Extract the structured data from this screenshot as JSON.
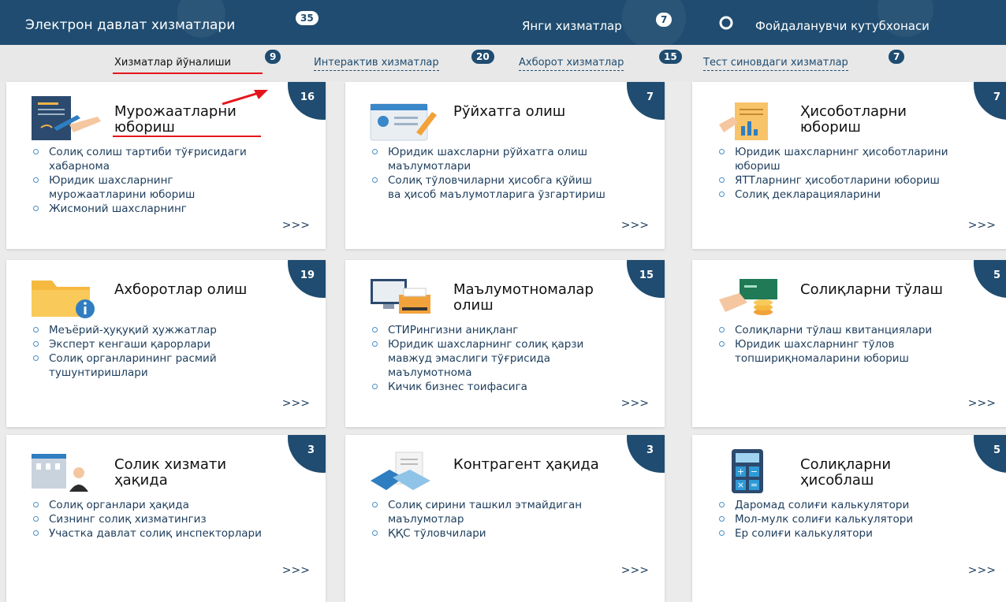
{
  "header": {
    "portal_title": "Электрон давлат хизматлари",
    "portal_count": "35",
    "new_services": "Янги хизматлар",
    "new_count": "7",
    "library": "Фойдаланувчи кутубхонаси"
  },
  "tabs": [
    {
      "label": "Хизматлар йўналиши",
      "count": "9"
    },
    {
      "label": "Интерактив хизматлар",
      "count": "20"
    },
    {
      "label": "Ахборот хизматлар",
      "count": "15"
    },
    {
      "label": "Тест синовдаги хизматлар",
      "count": "7"
    }
  ],
  "cards": [
    {
      "title": "Мурожаатларни юбориш",
      "count": "16",
      "icon": "document-pen-icon",
      "items": [
        "Солиқ солиш тартиби тўғрисидаги хабарнома",
        "Юридик шахсларнинг мурожаатларини юбориш",
        "Жисмоний шахсларнинг"
      ]
    },
    {
      "title": "Рўйхатга олиш",
      "count": "7",
      "icon": "id-card-icon",
      "items": [
        "Юридик шахсларни рўйхатга олиш маълумотлари",
        "Солиқ тўловчиларни ҳисобга қўйиш ва ҳисоб маълумотларига ўзгартириш"
      ]
    },
    {
      "title": "Ҳисоботларни юбориш",
      "count": "7",
      "icon": "report-chart-icon",
      "items": [
        "Юридик шахсларнинг ҳисоботларини юбориш",
        "ЯТТларнинг ҳисоботларини юбориш",
        "Солиқ декларацияларини"
      ]
    },
    {
      "title": "Ахборотлар олиш",
      "count": "19",
      "icon": "folder-info-icon",
      "items": [
        "Меъёрий-ҳуқуқий ҳужжатлар",
        "Эксперт кенгаши қарорлари",
        "Солиқ органларининг расмий тушунтиришлари"
      ]
    },
    {
      "title": "Маълумотномалар олиш",
      "count": "15",
      "icon": "computer-printer-icon",
      "items": [
        "СТИРингизни аниқланг",
        "Юридик шахсларнинг солиқ қарзи мавжуд эмаслиги тўғрисида маълумотнома",
        "Кичик бизнес тоифасига"
      ]
    },
    {
      "title": "Солиқларни тўлаш",
      "count": "5",
      "icon": "payment-card-icon",
      "items": [
        "Солиқларни тўлаш квитанциялари",
        "Юридик шахсларнинг тўлов топшириқномаларини юбориш"
      ]
    },
    {
      "title": "Солик хизмати ҳақида",
      "count": "3",
      "icon": "office-building-icon",
      "items": [
        "Солиқ органлари ҳақида",
        "Сизнинг солиқ хизматингиз",
        "Участка давлат солиқ инспекторлари"
      ]
    },
    {
      "title": "Контрагент ҳақида",
      "count": "3",
      "icon": "handshake-icon",
      "items": [
        "Солиқ сирини ташкил этмайдиган маълумотлар",
        "ҚҚС тўловчилари"
      ]
    },
    {
      "title": "Солиқларни ҳисоблаш",
      "count": "5",
      "icon": "calculator-icon",
      "items": [
        "Даромад солиғи калькулятори",
        "Мол-мулк солиғи калькулятори",
        "Ер солиғи калькулятори"
      ]
    }
  ],
  "more_label": ">>>",
  "colors": {
    "primary": "#1f4c70",
    "accent_red": "#e4161b",
    "bullet": "#4a8fc4"
  }
}
